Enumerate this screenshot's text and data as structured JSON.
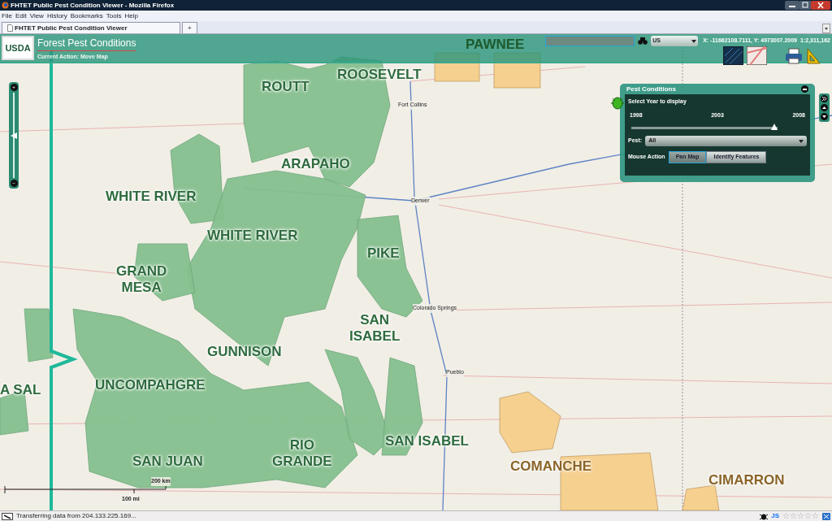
{
  "browser": {
    "title": "FHTET Public Pest Condition Viewer - Mozilla Firefox",
    "menu": [
      "File",
      "Edit",
      "View",
      "History",
      "Bookmarks",
      "Tools",
      "Help"
    ],
    "tabs": [
      {
        "label": "FHTET Public Pest Condition Viewer",
        "selected": true
      }
    ],
    "new_tab": "+"
  },
  "app": {
    "logo": "USDA",
    "title": "Forest Pest Conditions",
    "current_action": "Current Action: Move Map",
    "region_select": {
      "value": "US"
    },
    "coordinates": "X: -11662108.7111, Y: 4973007.2009",
    "scale": "1:2,311,162"
  },
  "map": {
    "areas": [
      {
        "label": "PAWNEE",
        "kind": "grassland"
      },
      {
        "label": "ROUTT",
        "kind": "forest"
      },
      {
        "label": "ROOSEVELT",
        "kind": "forest"
      },
      {
        "label": "ARAPAHO",
        "kind": "forest"
      },
      {
        "label": "WHITE RIVER",
        "kind": "forest"
      },
      {
        "label": "WHITE RIVER",
        "kind": "forest"
      },
      {
        "label": "PIKE",
        "kind": "forest"
      },
      {
        "label": "GRAND\nMESA",
        "kind": "forest"
      },
      {
        "label": "SAN\nISABEL",
        "kind": "forest"
      },
      {
        "label": "GUNNISON",
        "kind": "forest"
      },
      {
        "label": "A SAL",
        "kind": "forest"
      },
      {
        "label": "UNCOMPAHGRE",
        "kind": "forest"
      },
      {
        "label": "SAN JUAN",
        "kind": "forest"
      },
      {
        "label": "RIO\nGRANDE",
        "kind": "forest"
      },
      {
        "label": "SAN ISABEL",
        "kind": "forest"
      },
      {
        "label": "COMANCHE",
        "kind": "grassland"
      },
      {
        "label": "CIMARRON",
        "kind": "grassland"
      }
    ],
    "cities": [
      "Fort Collins",
      "Denver",
      "Colorado Springs",
      "Pueblo"
    ],
    "scale_bar": {
      "km": "200 km",
      "mi": "100 mi"
    }
  },
  "zoom_slider": {
    "zoom_in": "+",
    "zoom_out": "−",
    "level": 0.5
  },
  "pest_panel": {
    "title": "Pest Conditions",
    "year_prompt": "Select Year to display",
    "year_labels": [
      "1998",
      "2003",
      "2008"
    ],
    "level": 1,
    "pest": {
      "label": "Pest:",
      "value": "All"
    },
    "mouse_action": {
      "label": "Mouse Action",
      "buttons": [
        {
          "label": "Pan Map",
          "selected": true
        },
        {
          "label": "Identify Features",
          "selected": false
        }
      ]
    }
  },
  "status_bar": {
    "text": "Transferring data from 204.133.225.169...",
    "js": "JS",
    "stars": 0
  }
}
